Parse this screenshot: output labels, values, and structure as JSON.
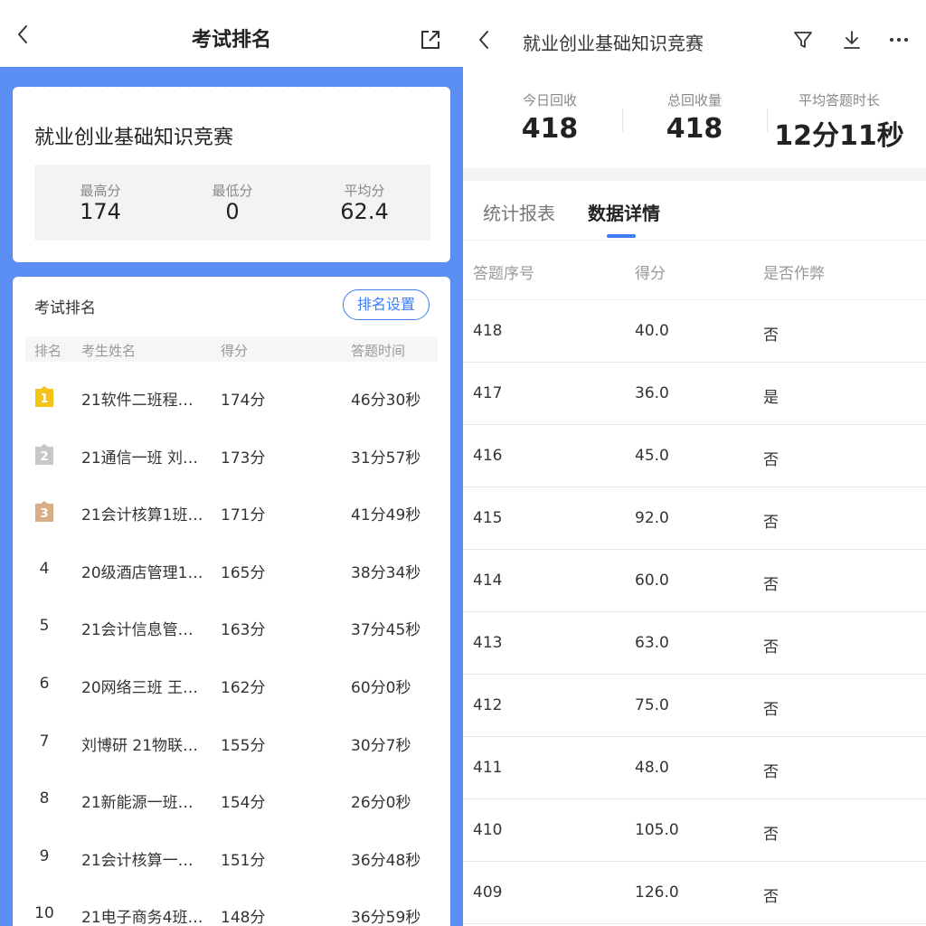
{
  "left": {
    "header_title": "考试排名",
    "contest_name": "就业创业基础知识竞赛",
    "stats": [
      {
        "label": "最高分",
        "value": "174"
      },
      {
        "label": "最低分",
        "value": "0"
      },
      {
        "label": "平均分",
        "value": "62.4"
      }
    ],
    "ranking_title": "考试排名",
    "ranking_setting_label": "排名设置",
    "columns": [
      "排名",
      "考生姓名",
      "得分",
      "答题时间"
    ],
    "rows": [
      {
        "rank": "1",
        "name": "21软件二班程…",
        "score": "174分",
        "time": "46分30秒",
        "medal": "gold"
      },
      {
        "rank": "2",
        "name": "21通信一班 刘…",
        "score": "173分",
        "time": "31分57秒",
        "medal": "silver"
      },
      {
        "rank": "3",
        "name": "21会计核算1班…",
        "score": "171分",
        "time": "41分49秒",
        "medal": "bronze"
      },
      {
        "rank": "4",
        "name": "20级酒店管理1…",
        "score": "165分",
        "time": "38分34秒"
      },
      {
        "rank": "5",
        "name": "21会计信息管…",
        "score": "163分",
        "time": "37分45秒"
      },
      {
        "rank": "6",
        "name": "20网络三班 王…",
        "score": "162分",
        "time": "60分0秒"
      },
      {
        "rank": "7",
        "name": "刘博研 21物联…",
        "score": "155分",
        "time": "30分7秒"
      },
      {
        "rank": "8",
        "name": "21新能源一班…",
        "score": "154分",
        "time": "26分0秒"
      },
      {
        "rank": "9",
        "name": "21会计核算一…",
        "score": "151分",
        "time": "36分48秒"
      },
      {
        "rank": "10",
        "name": "21电子商务4班…",
        "score": "148分",
        "time": "36分59秒"
      }
    ]
  },
  "right": {
    "header_title": "就业创业基础知识竞赛",
    "kpis": [
      {
        "label": "今日回收",
        "value": "418"
      },
      {
        "label": "总回收量",
        "value": "418"
      },
      {
        "label": "平均答题时长",
        "value": "12分11秒"
      }
    ],
    "tabs": [
      {
        "label": "统计报表",
        "active": false
      },
      {
        "label": "数据详情",
        "active": true
      }
    ],
    "columns": [
      "答题序号",
      "得分",
      "是否作弊"
    ],
    "rows": [
      {
        "id": "418",
        "score": "40.0",
        "cheat": "否"
      },
      {
        "id": "417",
        "score": "36.0",
        "cheat": "是"
      },
      {
        "id": "416",
        "score": "45.0",
        "cheat": "否"
      },
      {
        "id": "415",
        "score": "92.0",
        "cheat": "否"
      },
      {
        "id": "414",
        "score": "60.0",
        "cheat": "否"
      },
      {
        "id": "413",
        "score": "63.0",
        "cheat": "否"
      },
      {
        "id": "412",
        "score": "75.0",
        "cheat": "否"
      },
      {
        "id": "411",
        "score": "48.0",
        "cheat": "否"
      },
      {
        "id": "410",
        "score": "105.0",
        "cheat": "否"
      },
      {
        "id": "409",
        "score": "126.0",
        "cheat": "否"
      }
    ]
  },
  "icons": {
    "back": "chevron-left-icon",
    "share": "external-link-icon",
    "filter": "filter-icon",
    "download": "download-icon",
    "more": "more-dots-icon",
    "medal_gold": "gold-medal-icon",
    "medal_silver": "silver-medal-icon",
    "medal_bronze": "bronze-medal-icon"
  },
  "colors": {
    "accent": "#3d7ef5",
    "panel_bg": "#5b8ef3",
    "gold": "#f5c21a",
    "silver": "#c7c7c7",
    "bronze": "#d8ae84"
  }
}
